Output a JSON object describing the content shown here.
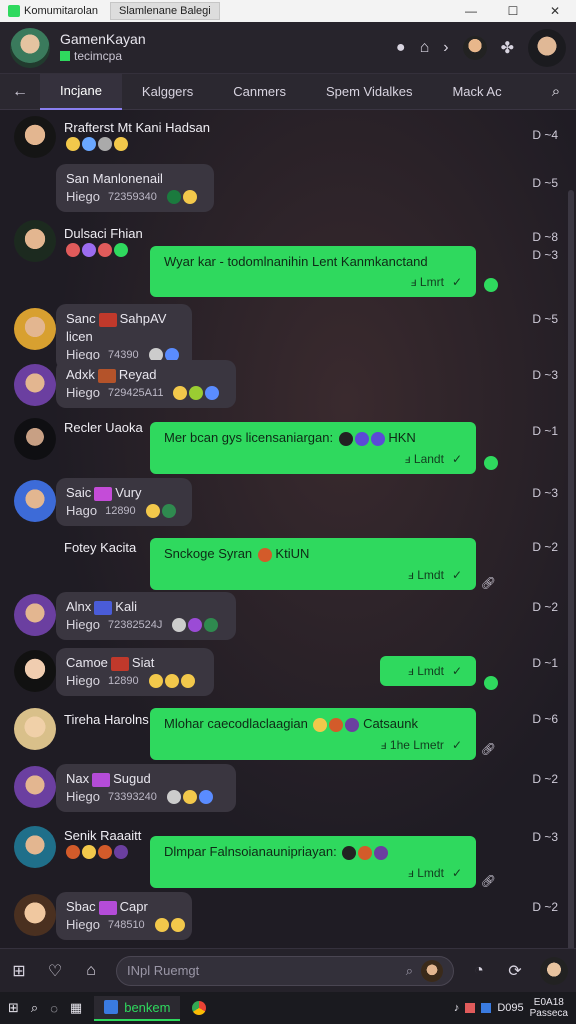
{
  "window": {
    "tab1_title": "Komumitarolan",
    "tab2_title": "Slamlenane Balegi",
    "min": "—",
    "max": "☐",
    "close": "✕"
  },
  "header": {
    "title": "GamenKayan",
    "subtitle": "tecimcpa"
  },
  "tabs": [
    "Incjane",
    "Kalggers",
    "Canmers",
    "Spem Vidalkes",
    "Mack Ac"
  ],
  "messages": [
    {
      "name": "Rrafterst Mt Kani Hadsan",
      "time": "D ~4"
    },
    {
      "card_l1": "San Manlonenail",
      "card_l2": "Hiego",
      "card_num": "72359340",
      "time": "D ~5"
    },
    {
      "name": "Dulsaci Fhian",
      "time": "D ~8",
      "time2": "D ~3",
      "bubble": "Wyar kar - todomlnanihin Lent Kanmkanctand",
      "foot": "ⅎ Lmrt"
    },
    {
      "card_l1": "Sanc",
      "card_badge": "SahpAV licen",
      "card_l2": "Hiego",
      "card_num": "74390",
      "time": "D ~5"
    },
    {
      "card_l1": "Adxk",
      "card_badge": "Reyad",
      "card_l2": "Hiego",
      "card_num": "729425A11",
      "time": "D ~3"
    },
    {
      "name": "Recler Uaoka",
      "bubble": "Mer bcan gys licensaniargan:",
      "bubble_tail": "HKN",
      "foot": "ⅎ Landt",
      "time": "D ~1"
    },
    {
      "card_l1": "Saic",
      "card_badge": "Vury",
      "card_l2": "Hago",
      "card_num": "12890",
      "time": "D ~3"
    },
    {
      "name": "Fotey Kacita",
      "bubble": "Snckoge Syran",
      "bubble_tail": "KtiUN",
      "foot": "ⅎ Lmdt",
      "time": "D ~2"
    },
    {
      "card_l1": "Alnx",
      "card_badge": "Kali",
      "card_l2": "Hiego",
      "card_num": "72382524J",
      "time": "D ~2"
    },
    {
      "card_l1": "Camoe",
      "card_badge": "Siat",
      "card_l2": "Hiego",
      "card_num": "12890",
      "bubble": "",
      "foot": "ⅎ Lmdt",
      "time": "D ~1"
    },
    {
      "name": "Tireha Harolns",
      "bubble": "Mlohar caecodlaclaagian",
      "bubble_tail": "Catsaunk",
      "foot": "ⅎ 1he Lmetr",
      "time": "D ~6"
    },
    {
      "card_l1": "Nax",
      "card_badge": "Sugud",
      "card_l2": "Hiego",
      "card_num": "73393240",
      "time": "D ~2"
    },
    {
      "name": "Senik Raaaitt",
      "bubble": "Dlmpar Falnsoianaunipriayan:",
      "foot": "ⅎ Lmdt",
      "time": "D ~3"
    },
    {
      "card_l1": "Sbac",
      "card_badge": "Capr",
      "card_l2": "Hiego",
      "card_num": "748510",
      "time": "D ~2"
    }
  ],
  "composer": {
    "placeholder": "INpl Ruemgt"
  },
  "taskbar": {
    "app_label": "benkem",
    "tray_text": "D095",
    "clock_l1": "E0A18",
    "clock_l2": "Passeca"
  },
  "colors": {
    "bubble": "#2fd95e",
    "card": "#3a3640",
    "accent": "#8a7ff0"
  }
}
